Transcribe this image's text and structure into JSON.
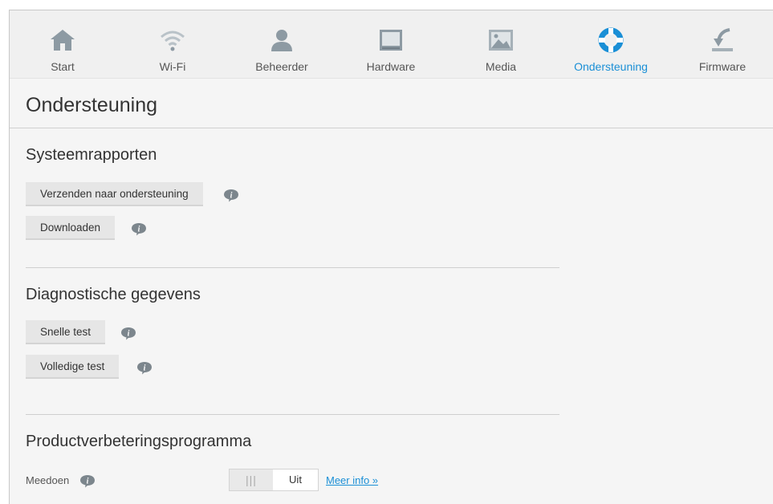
{
  "nav": {
    "items": [
      {
        "label": "Start",
        "icon": "home-icon"
      },
      {
        "label": "Wi-Fi",
        "icon": "wifi-icon"
      },
      {
        "label": "Beheerder",
        "icon": "user-icon"
      },
      {
        "label": "Hardware",
        "icon": "hardware-icon"
      },
      {
        "label": "Media",
        "icon": "media-icon"
      },
      {
        "label": "Ondersteuning",
        "icon": "lifebuoy-icon",
        "active": true
      },
      {
        "label": "Firmware",
        "icon": "firmware-icon"
      }
    ],
    "active_color": "#1a8fd6"
  },
  "page": {
    "title": "Ondersteuning"
  },
  "sections": {
    "reports": {
      "title": "Systeemrapporten",
      "send_label": "Verzenden naar ondersteuning",
      "download_label": "Downloaden"
    },
    "diagnostics": {
      "title": "Diagnostische gegevens",
      "quick_label": "Snelle test",
      "full_label": "Volledige test"
    },
    "improvement": {
      "title": "Productverbeteringsprogramma",
      "participate_label": "Meedoen",
      "toggle_grip": "|||",
      "toggle_state": "Uit",
      "more_info": "Meer info »"
    }
  }
}
